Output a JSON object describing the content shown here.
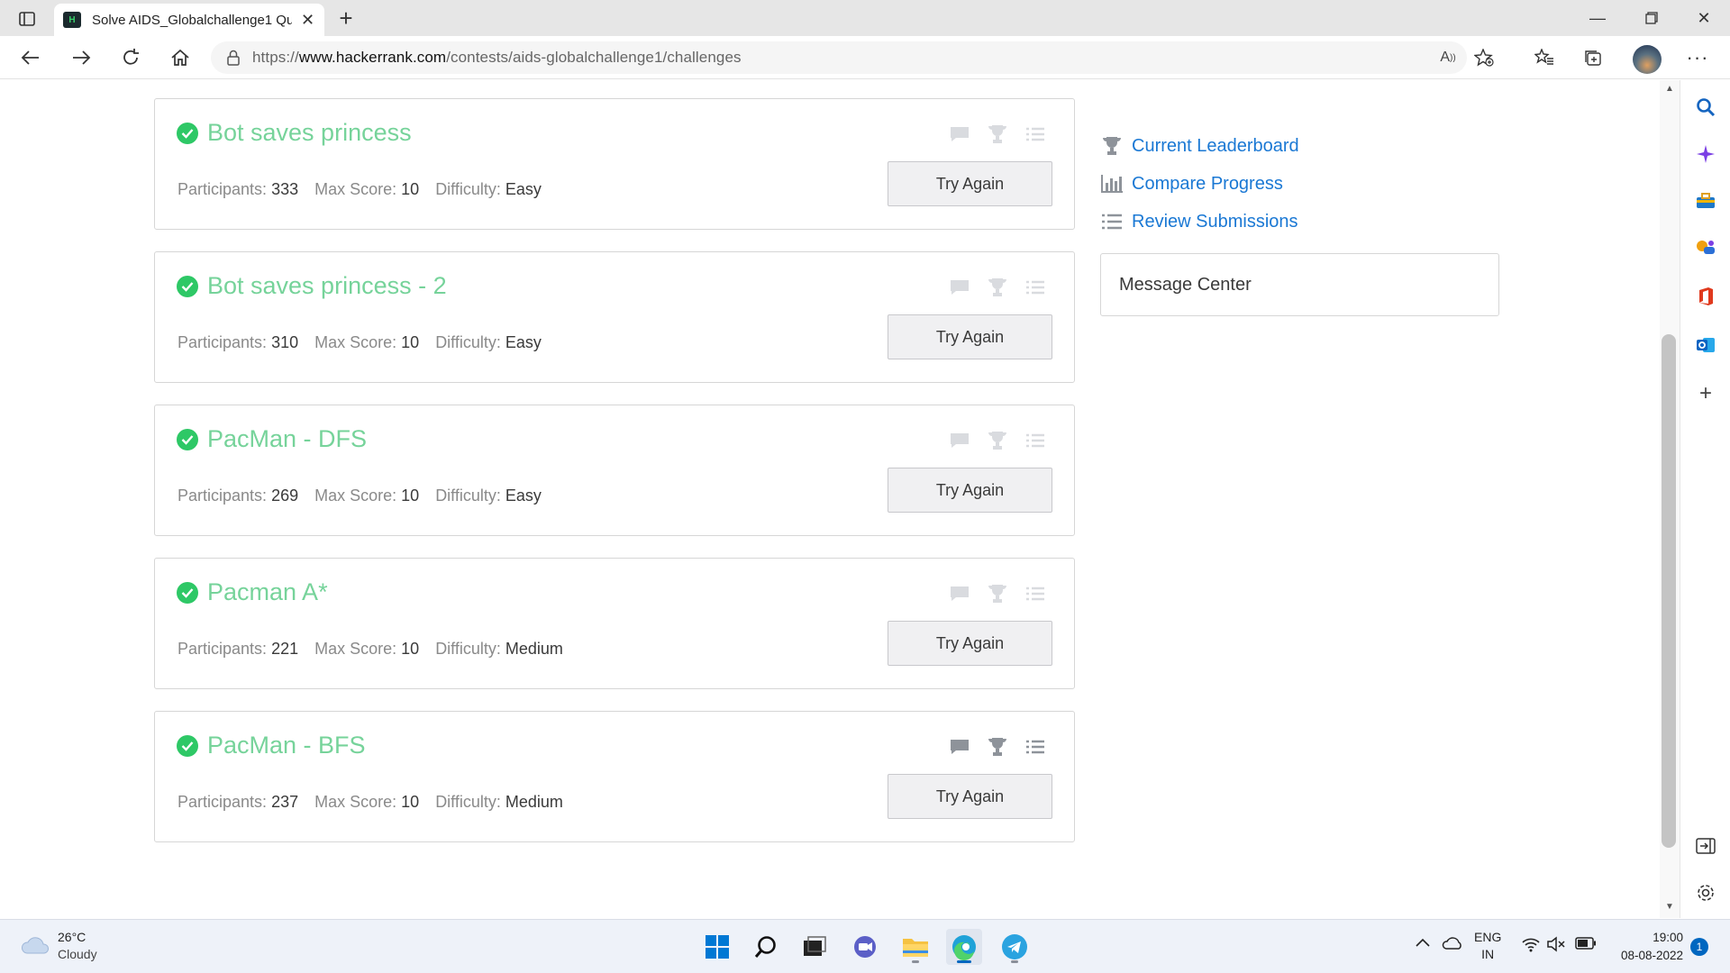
{
  "browser": {
    "tab_title": "Solve AIDS_Globalchallenge1 Qu",
    "favicon_text": "H",
    "url_prefix": "https://",
    "url_host": "www.hackerrank.com",
    "url_path": "/contests/aids-globalchallenge1/challenges"
  },
  "challenges": [
    {
      "name": "Bot saves princess",
      "participants": "333",
      "max_score": "10",
      "difficulty": "Easy",
      "button": "Try Again"
    },
    {
      "name": "Bot saves princess - 2",
      "participants": "310",
      "max_score": "10",
      "difficulty": "Easy",
      "button": "Try Again"
    },
    {
      "name": "PacMan - DFS",
      "participants": "269",
      "max_score": "10",
      "difficulty": "Easy",
      "button": "Try Again"
    },
    {
      "name": "Pacman A*",
      "participants": "221",
      "max_score": "10",
      "difficulty": "Medium",
      "button": "Try Again"
    },
    {
      "name": "PacMan - BFS",
      "participants": "237",
      "max_score": "10",
      "difficulty": "Medium",
      "button": "Try Again"
    }
  ],
  "labels": {
    "participants": "Participants:",
    "max_score": "Max Score:",
    "difficulty": "Difficulty:"
  },
  "sidebar": {
    "links": [
      "Current Leaderboard",
      "Compare Progress",
      "Review Submissions"
    ],
    "message_center": "Message Center"
  },
  "taskbar": {
    "temperature": "26°C",
    "weather": "Cloudy",
    "lang_1": "ENG",
    "lang_2": "IN",
    "time": "19:00",
    "date": "08-08-2022",
    "notifications": "1"
  },
  "colors": {
    "solved_green": "#2ec866",
    "title_green": "#76d39a",
    "link_blue": "#1a78d4"
  }
}
